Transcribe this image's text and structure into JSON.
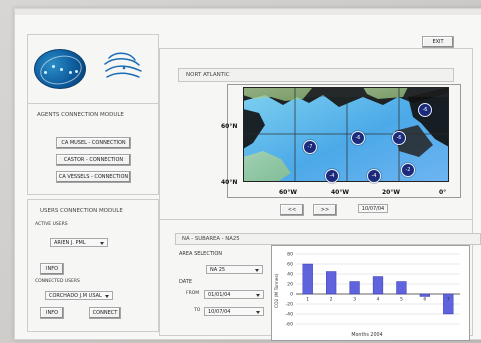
{
  "window": {
    "exit_label": "EXIT"
  },
  "logos": {
    "left_logo_icon": "spacecraft-globe-icon",
    "right_logo_icon": "waves-icon"
  },
  "agents": {
    "title": "AGENTS CONNECTION MODULE",
    "buttons": [
      {
        "label": "CA MUSEL - CONNECTION"
      },
      {
        "label": "CASTOR - CONNECTION"
      },
      {
        "label": "CA VESSELS - CONNECTION"
      }
    ]
  },
  "users": {
    "title": "USERS CONNECTION MODULE",
    "active_users_label": "ACTIVE USERS",
    "active_user_selected": "ARIEN J. PML",
    "info1_label": "INFO",
    "connected_users_label": "CONNECTED USERS",
    "connected_user_selected": "CORCHADO J.M USAL",
    "info2_label": "INFO",
    "connect_label": "CONNECT"
  },
  "map": {
    "region_title": "NORT   ATLANTIC",
    "lat_labels": [
      "60°N",
      "40°N"
    ],
    "lon_labels": [
      "60°W",
      "40°W",
      "20°W",
      "0°"
    ],
    "badges": [
      "-6",
      "-7",
      "-6",
      "-6",
      "-4",
      "-4",
      "-2"
    ],
    "nav_prev": "<<",
    "nav_next": ">>",
    "date": "10/07/04"
  },
  "subarea": {
    "header": "NA  -  SUBAREA  -  NA25",
    "area_selection_label": "AREA SELECTION",
    "area_selected": "NA 25",
    "date_label": "DATE",
    "from_label": "FROM",
    "from_value": "01/01/04",
    "to_label": "TO",
    "to_value": "10/07/04"
  },
  "chart_data": {
    "type": "bar",
    "ylabel": "CO2 (M Tonnes)",
    "xlabel": "Months 2004",
    "categories": [
      "1",
      "2",
      "3",
      "4",
      "5",
      "6",
      "7"
    ],
    "values": [
      60,
      45,
      25,
      35,
      25,
      -5,
      -40
    ],
    "ylim": [
      -60,
      80
    ],
    "yticks": [
      80,
      60,
      40,
      20,
      0,
      -20,
      -40,
      -60
    ],
    "grid": true,
    "colors": {
      "bar": "#5f63de",
      "grid": "#d1d1d1",
      "zero": "#333333"
    }
  }
}
